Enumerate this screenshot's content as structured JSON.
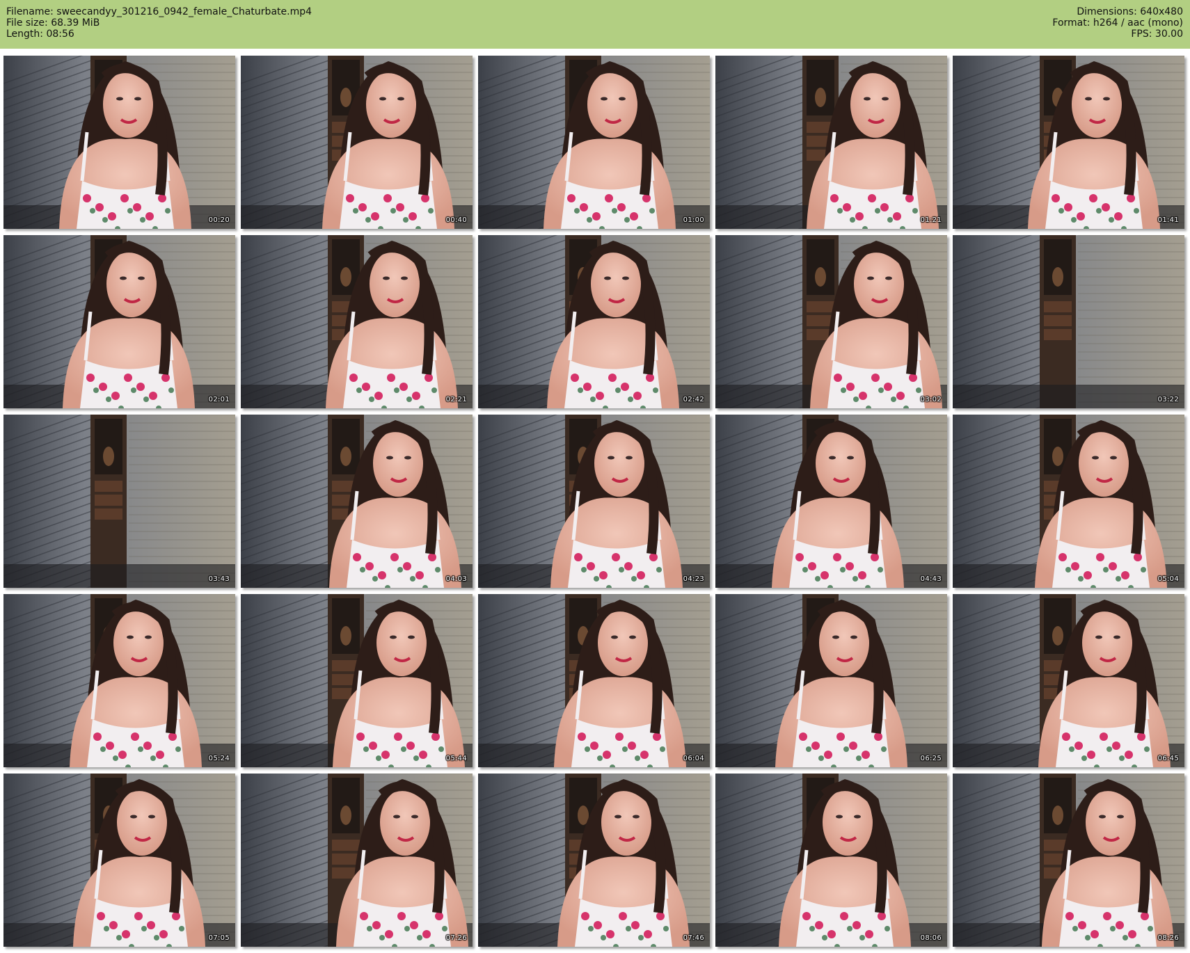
{
  "header": {
    "filename": "Filename: sweecandyy_301216_0942_female_Chaturbate.mp4",
    "file_size": "File size: 68.39 MiB",
    "length": "Length: 08:56",
    "dimensions": "Dimensions: 640x480",
    "format": "Format: h264 / aac (mono)",
    "fps": "FPS: 30.00"
  },
  "colors": {
    "header_bg": "#b2cf82",
    "page_bg": "#ffffff"
  },
  "frames": [
    {
      "time": "00:20",
      "subject": true
    },
    {
      "time": "00:40",
      "subject": true
    },
    {
      "time": "01:00",
      "subject": true
    },
    {
      "time": "01:21",
      "subject": true
    },
    {
      "time": "01:41",
      "subject": true
    },
    {
      "time": "02:01",
      "subject": true
    },
    {
      "time": "02:21",
      "subject": true
    },
    {
      "time": "02:42",
      "subject": true
    },
    {
      "time": "03:02",
      "subject": true
    },
    {
      "time": "03:22",
      "subject": false
    },
    {
      "time": "03:43",
      "subject": false
    },
    {
      "time": "04:03",
      "subject": true
    },
    {
      "time": "04:23",
      "subject": true
    },
    {
      "time": "04:43",
      "subject": true
    },
    {
      "time": "05:04",
      "subject": true
    },
    {
      "time": "05:24",
      "subject": true
    },
    {
      "time": "05:44",
      "subject": true
    },
    {
      "time": "06:04",
      "subject": true
    },
    {
      "time": "06:25",
      "subject": true
    },
    {
      "time": "06:45",
      "subject": true
    },
    {
      "time": "07:05",
      "subject": true
    },
    {
      "time": "07:26",
      "subject": true
    },
    {
      "time": "07:46",
      "subject": true
    },
    {
      "time": "08:06",
      "subject": true
    },
    {
      "time": "08:26",
      "subject": true
    }
  ]
}
